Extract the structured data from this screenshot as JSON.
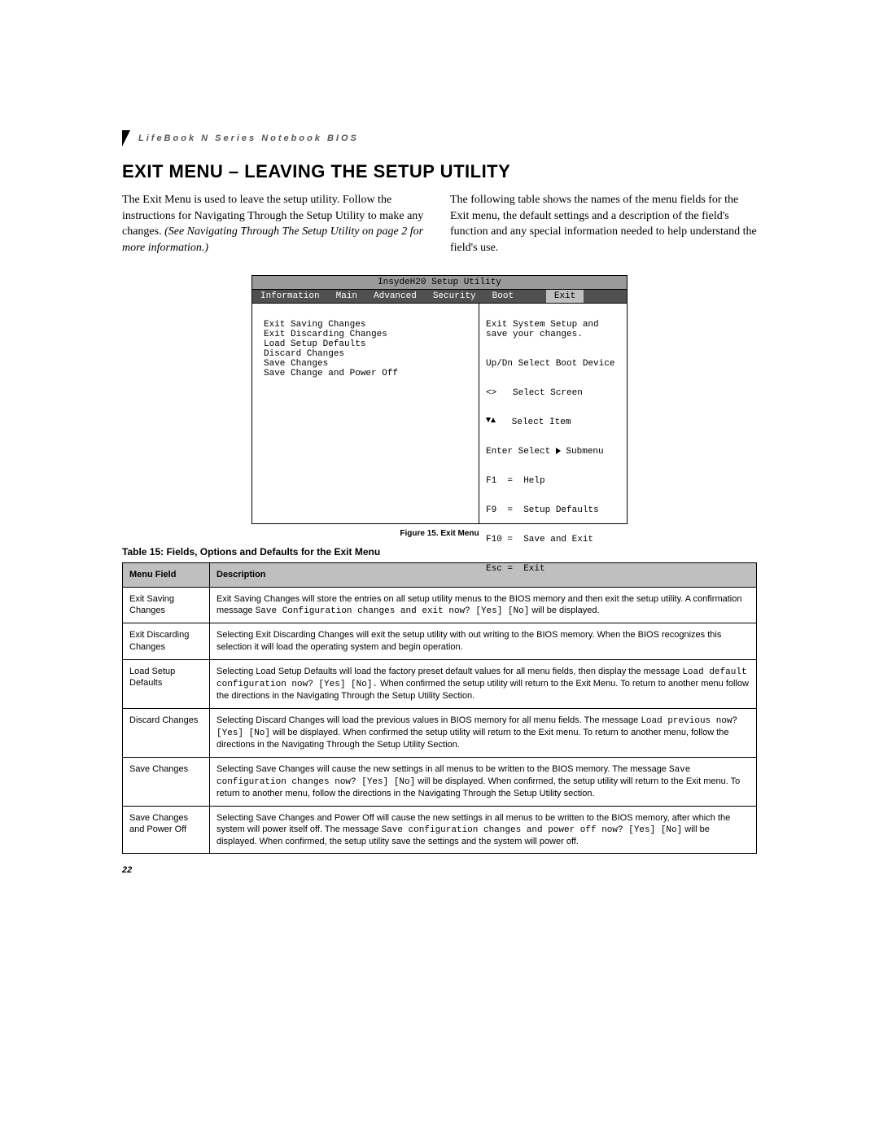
{
  "header": {
    "running_head": "LifeBook N Series Notebook BIOS"
  },
  "title": "EXIT MENU – LEAVING THE SETUP UTILITY",
  "para_left": {
    "t1": "The Exit Menu is used to leave the setup utility. Follow the instructions for Navigating Through the Setup Utility to make any changes. ",
    "ref": "(See Navigating Through The Setup Utility on page 2 for more information.)"
  },
  "para_right": "The following table shows the names of the menu fields for the Exit menu, the default settings and a description of the field's function and any special information needed to help understand the field's use.",
  "bios": {
    "title": "InsydeH20 Setup Utility",
    "tabs": [
      "Information",
      "Main",
      "Advanced",
      "Security",
      "Boot",
      "Exit"
    ],
    "active_tab_index": 5,
    "left_items": [
      "Exit Saving Changes",
      "Exit Discarding Changes",
      "Load Setup Defaults",
      "Discard Changes",
      "Save Changes",
      "Save Change and Power Off"
    ],
    "help_text": "Exit System Setup and\nsave your changes.",
    "key_hints": {
      "line1": "Up/Dn Select Boot Device",
      "line2a": "<>",
      "line2b": "   Select Screen",
      "line3b": "   Select Item",
      "line4": "Enter Select ",
      "line4b": " Submenu",
      "line5": "F1  =  Help",
      "line6": "F9  =  Setup Defaults",
      "line7": "F10 =  Save and Exit",
      "line8": "Esc =  Exit"
    }
  },
  "figure_caption": "Figure 15.  Exit Menu",
  "table_caption": "Table 15: Fields, Options and Defaults for the Exit Menu",
  "table": {
    "head": {
      "c1": "Menu Field",
      "c2": "Description"
    },
    "rows": [
      {
        "field": "Exit Saving Changes",
        "desc_a": "Exit Saving Changes will store the entries on all setup utility menus to the BIOS memory and then exit the setup utility. A confirmation message ",
        "mono1": "Save Configuration changes and exit now? [Yes] [No]",
        "desc_b": " will be displayed."
      },
      {
        "field": "Exit Discarding Changes",
        "desc_a": "Selecting Exit Discarding Changes will exit the setup utility with out writing to the BIOS memory. When the BIOS recognizes this selection it will load the operating system and begin operation.",
        "mono1": "",
        "desc_b": ""
      },
      {
        "field": "Load Setup Defaults",
        "desc_a": "Selecting Load Setup Defaults will load the factory preset default values for all menu fields, then display the message ",
        "mono1": "Load default configuration now? [Yes] [No].",
        "desc_b": " When confirmed the setup utility will return to the Exit Menu. To return to another menu follow the directions in the Navigating Through the Setup Utility Section."
      },
      {
        "field": "Discard Changes",
        "desc_a": "Selecting Discard Changes will load the previous values in BIOS memory for all menu fields. The message ",
        "mono1": "Load previous now? [Yes] [No]",
        "desc_b": " will be displayed. When confirmed the setup utility will return to the Exit menu. To return to another menu, follow the directions in the Navigating Through the Setup Utility Section."
      },
      {
        "field": "Save Changes",
        "desc_a": "Selecting Save Changes will cause the new settings in all menus to be written to the BIOS memory. The message ",
        "mono1": "Save configuration changes now? [Yes] [No]",
        "desc_b": " will be displayed. When confirmed, the setup utility will return to the Exit menu. To return to another menu, follow the directions in the Navigating Through the Setup Utility section."
      },
      {
        "field": "Save Changes and Power Off",
        "desc_a": "Selecting Save Changes and Power Off will cause the new settings in all menus to be written to the BIOS memory, after which the system will power itself off. The message ",
        "mono1": "Save configuration changes and power off now? [Yes] [No]",
        "desc_b": " will be displayed. When confirmed, the setup utility save the settings and the system will power off."
      }
    ]
  },
  "page_number": "22"
}
